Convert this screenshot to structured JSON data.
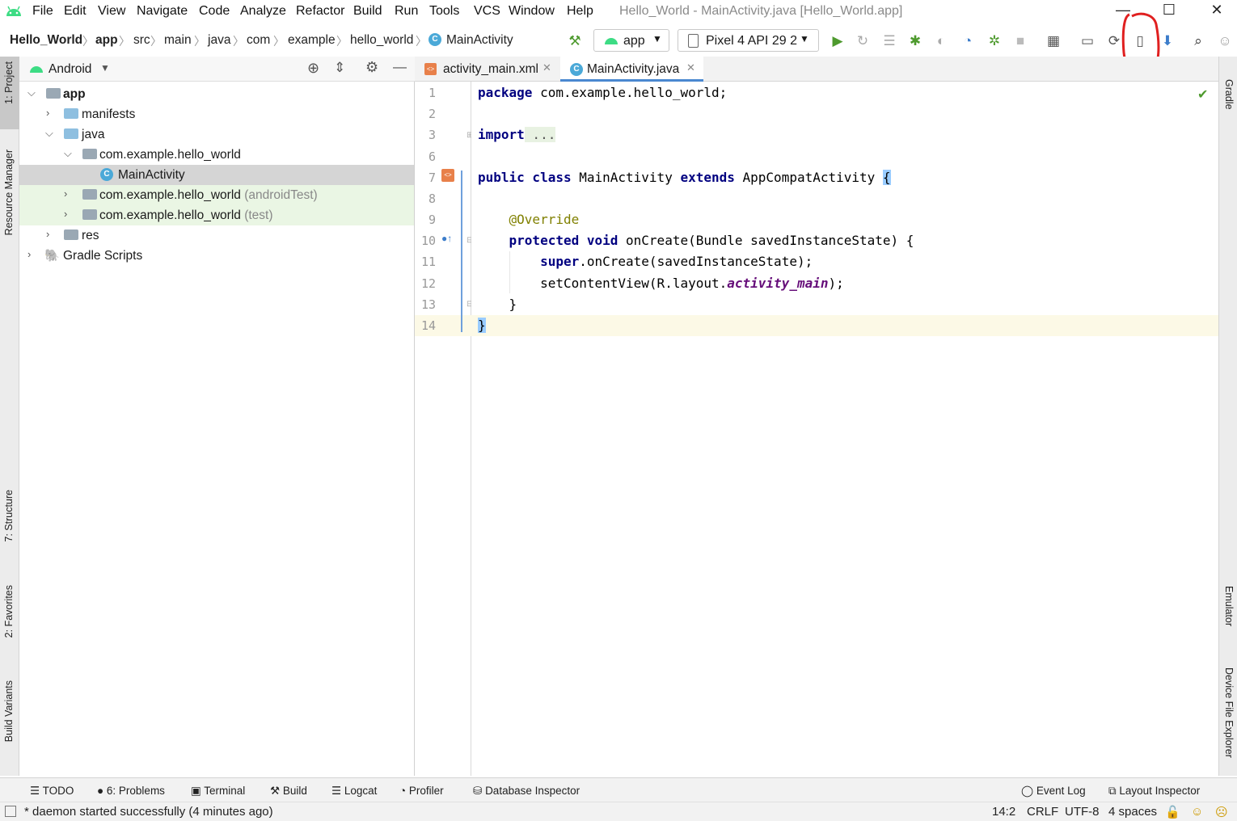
{
  "menubar": {
    "items": [
      "File",
      "Edit",
      "View",
      "Navigate",
      "Code",
      "Analyze",
      "Refactor",
      "Build",
      "Run",
      "Tools",
      "VCS",
      "Window",
      "Help"
    ],
    "title": "Hello_World - MainActivity.java [Hello_World.app]"
  },
  "breadcrumb": [
    "Hello_World",
    "app",
    "src",
    "main",
    "java",
    "com",
    "example",
    "hello_world",
    "MainActivity"
  ],
  "toolbar": {
    "run_config": "app",
    "device": "Pixel 4 API 29 2"
  },
  "left_tool_windows": [
    "1: Project",
    "Resource Manager",
    "7: Structure",
    "2: Favorites",
    "Build Variants"
  ],
  "right_tool_windows": [
    "Gradle",
    "Emulator",
    "Device File Explorer"
  ],
  "project": {
    "view_mode": "Android",
    "tree": [
      {
        "label": "app",
        "bold": true
      },
      {
        "label": "manifests"
      },
      {
        "label": "java"
      },
      {
        "label": "com.example.hello_world"
      },
      {
        "label": "MainActivity",
        "selected": true
      },
      {
        "label": "com.example.hello_world",
        "suffix": "(androidTest)"
      },
      {
        "label": "com.example.hello_world",
        "suffix": "(test)"
      },
      {
        "label": "res"
      },
      {
        "label": "Gradle Scripts"
      }
    ]
  },
  "editor": {
    "tabs": [
      "activity_main.xml",
      "MainActivity.java"
    ],
    "active_tab": "MainActivity.java",
    "line_numbers": [
      "1",
      "2",
      "3",
      "6",
      "7",
      "8",
      "9",
      "10",
      "11",
      "12",
      "13",
      "14"
    ],
    "lines": {
      "l1a": "package",
      "l1b": " com.example.hello_world;",
      "l3a": "import",
      "l3b": " ...",
      "l7a": "public class",
      "l7b": " MainActivity ",
      "l7c": "extends",
      "l7d": " AppCompatActivity ",
      "l7e": "{",
      "l9": "@Override",
      "l10a": "protected void",
      "l10b": " onCreate(Bundle savedInstanceState) {",
      "l11a": "super",
      ".l11b": "",
      "l11b": ".onCreate(savedInstanceState);",
      "l12a": "setContentView(R.layout.",
      "l12b": "activity_main",
      "l12c": ");",
      "l13": "}",
      "l14": "}"
    }
  },
  "bottom_tabs": [
    "TODO",
    "6: Problems",
    "Terminal",
    "Build",
    "Logcat",
    "Profiler",
    "Database Inspector",
    "Event Log",
    "Layout Inspector"
  ],
  "status": {
    "message": "* daemon started successfully (4 minutes ago)",
    "position": "14:2",
    "line_sep": "CRLF",
    "encoding": "UTF-8",
    "indent": "4 spaces"
  },
  "colors": {
    "accent": "#3d7dca",
    "annotation_circle": "#e02020",
    "android_green": "#3ddc84"
  }
}
